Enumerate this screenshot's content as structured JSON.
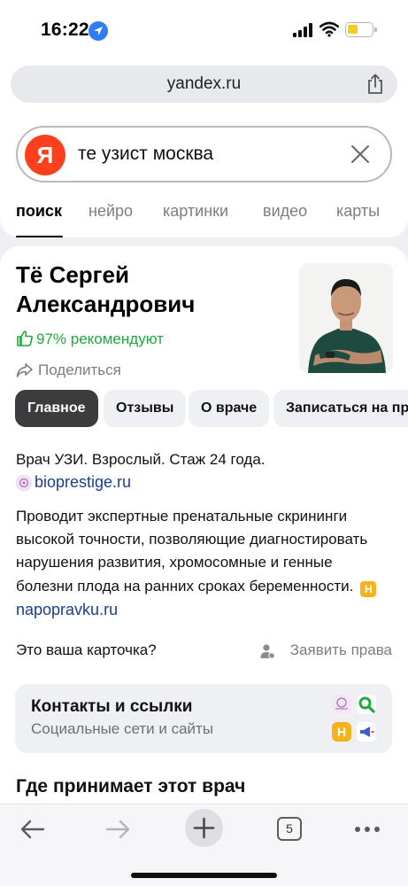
{
  "status_bar": {
    "time": "16:22"
  },
  "address_bar": {
    "url": "yandex.ru"
  },
  "search": {
    "logo_letter": "Я",
    "query": "те узист москва",
    "tabs": [
      "поиск",
      "нейро",
      "картинки",
      "видео",
      "карты"
    ],
    "active_tab": "поиск"
  },
  "doctor": {
    "name": "Тё Сергей Александрович",
    "recommend": "97% рекомендуют",
    "share_label": "Поделиться",
    "chips": [
      "Главное",
      "Отзывы",
      "О враче",
      "Записаться на при"
    ],
    "info_line": "Врач УЗИ. Взрослый. Стаж 24 года.",
    "site": "bioprestige.ru",
    "description": "Проводит экспертные пренатальные скрининги высокой точности, позволяющие диагностировать нарушения развития, хромосомные и генные болезни плода на ранних сроках беременности.",
    "source_badge": "Н",
    "source_link": "napopravku.ru",
    "claim_question": "Это ваша карточка?",
    "claim_link": "Заявить права"
  },
  "contacts": {
    "title": "Контакты и ссылки",
    "subtitle": "Социальные сети и сайты",
    "badge_letter": "Н"
  },
  "where_title": "Где принимает этот врач",
  "bottom_nav": {
    "tabs_count": "5"
  },
  "colors": {
    "accent_green": "#1eaa3d",
    "link_blue": "#1a3e8f",
    "yandex_red": "#fc3f1d",
    "badge_yellow": "#f6b21b"
  }
}
